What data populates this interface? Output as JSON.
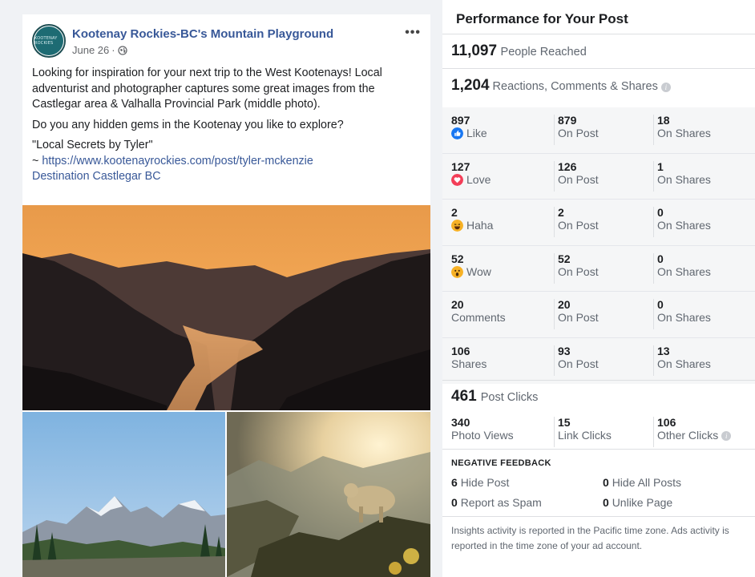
{
  "post": {
    "page_name": "Kootenay Rockies-BC's Mountain Playground",
    "avatar_text": "KOOTENAY ROCKIES",
    "date": "June 26",
    "separator": "·",
    "text_1": "Looking for inspiration for your next trip to the West Kootenays! Local adventurist and photographer captures some great images from the Castlegar area & Valhalla Provincial Park (middle photo).",
    "text_2": "Do you any hidden gems in the Kootenay you like to explore?",
    "text_3": "\"Local Secrets by Tyler\"",
    "link_prefix": "~ ",
    "link_url": "https://www.kootenayrockies.com/post/tyler-mckenzie",
    "link_destination": "Destination Castlegar BC",
    "icons": {
      "privacy": "globe-icon",
      "more": "more-options-icon"
    }
  },
  "panel": {
    "title": "Performance for Your Post",
    "reach_num": "11,097",
    "reach_label": "People Reached",
    "engagement_num": "1,204",
    "engagement_label": "Reactions, Comments & Shares",
    "rows": [
      {
        "num": "897",
        "label": "Like",
        "icon": "like-icon",
        "post_num": "879",
        "post_label": "On Post",
        "shares_num": "18",
        "shares_label": "On Shares"
      },
      {
        "num": "127",
        "label": "Love",
        "icon": "love-icon",
        "post_num": "126",
        "post_label": "On Post",
        "shares_num": "1",
        "shares_label": "On Shares"
      },
      {
        "num": "2",
        "label": "Haha",
        "icon": "haha-icon",
        "post_num": "2",
        "post_label": "On Post",
        "shares_num": "0",
        "shares_label": "On Shares"
      },
      {
        "num": "52",
        "label": "Wow",
        "icon": "wow-icon",
        "post_num": "52",
        "post_label": "On Post",
        "shares_num": "0",
        "shares_label": "On Shares"
      },
      {
        "num": "20",
        "label": "Comments",
        "icon": "",
        "post_num": "20",
        "post_label": "On Post",
        "shares_num": "0",
        "shares_label": "On Shares"
      },
      {
        "num": "106",
        "label": "Shares",
        "icon": "",
        "post_num": "93",
        "post_label": "On Post",
        "shares_num": "13",
        "shares_label": "On Shares"
      }
    ],
    "clicks_num": "461",
    "clicks_label": "Post Clicks",
    "clicks": [
      {
        "num": "340",
        "label": "Photo Views"
      },
      {
        "num": "15",
        "label": "Link Clicks"
      },
      {
        "num": "106",
        "label": "Other Clicks"
      }
    ],
    "negative_title": "NEGATIVE FEEDBACK",
    "negative": [
      {
        "num": "6",
        "label": "Hide Post"
      },
      {
        "num": "0",
        "label": "Hide All Posts"
      },
      {
        "num": "0",
        "label": "Report as Spam"
      },
      {
        "num": "0",
        "label": "Unlike Page"
      }
    ],
    "footer_note": "Insights activity is reported in the Pacific time zone. Ads activity is reported in the time zone of your ad account.",
    "colors": {
      "like": "#1877f2",
      "love": "#f33e58",
      "haha": "#f7b125",
      "link": "#385898"
    }
  }
}
